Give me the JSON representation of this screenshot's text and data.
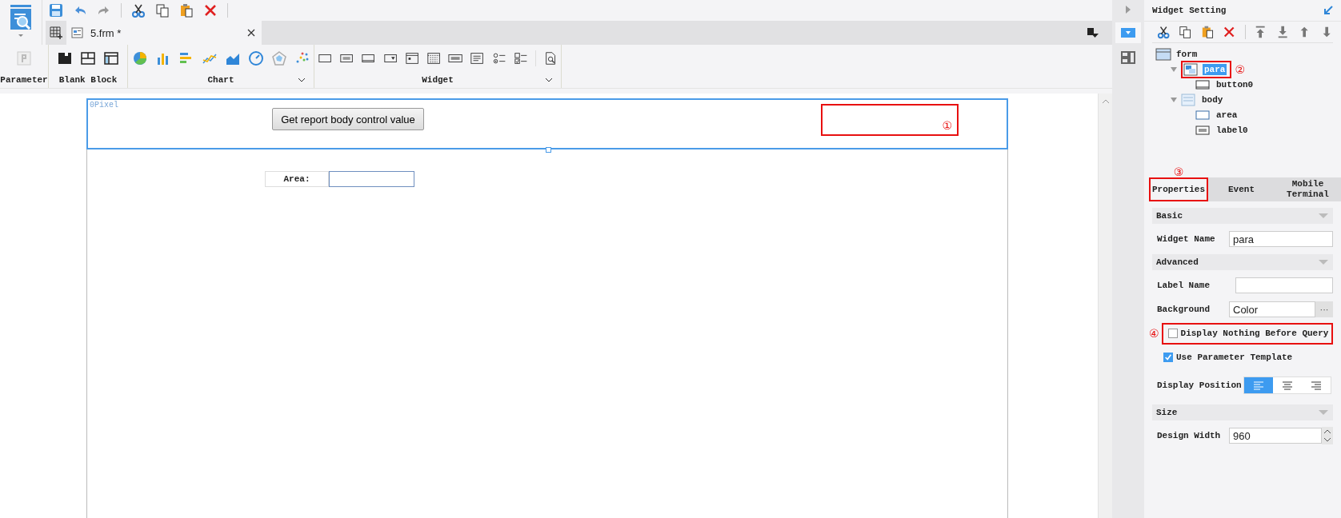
{
  "tabs": [
    {
      "label": "5.frm *",
      "selected": true
    }
  ],
  "ribbon_groups": [
    {
      "kind": "parameter",
      "label": "Parameter"
    },
    {
      "kind": "block",
      "label": "Blank Block"
    },
    {
      "kind": "chart",
      "label": "Chart"
    },
    {
      "kind": "widget",
      "label": "Widget"
    }
  ],
  "canvas": {
    "pane_label": "0Pixel",
    "button": "Get report body control value",
    "callout": "①",
    "fields": [
      {
        "label": "Area:"
      }
    ]
  },
  "side_panel": {
    "title": "Widget Setting",
    "tree": [
      {
        "label": "form",
        "kind": "form",
        "selected": false,
        "children": [
          {
            "label": "para",
            "kind": "para",
            "selected": true,
            "callout": "②",
            "expanded": true,
            "children": [
              {
                "label": "button0",
                "kind": "button",
                "selected": false
              }
            ]
          },
          {
            "label": "body",
            "kind": "body",
            "selected": false,
            "expanded": true,
            "children": [
              {
                "label": "area",
                "kind": "area",
                "selected": false
              },
              {
                "label": "label0",
                "kind": "label",
                "selected": false
              }
            ]
          }
        ]
      }
    ],
    "tabs": [
      {
        "label": "Properties",
        "selected": true,
        "callout": "③"
      },
      {
        "label": "Event",
        "selected": false
      },
      {
        "label": "Mobile Terminal",
        "selected": false
      }
    ],
    "rows": [
      {
        "kind": "section",
        "label": "Basic"
      },
      {
        "kind": "text",
        "label": "Widget Name",
        "value": "para"
      },
      {
        "kind": "section",
        "label": "Advanced"
      },
      {
        "kind": "text",
        "label": "Label Name"
      },
      {
        "kind": "color",
        "label": "Background",
        "value": "Color",
        "button": "···"
      },
      {
        "kind": "checkbox",
        "label": "Display Nothing Before Query",
        "checked": false,
        "callout": "④"
      },
      {
        "kind": "checkbox",
        "label": "Use Parameter Template",
        "checked": true
      },
      {
        "kind": "align",
        "label": "Display Position",
        "options": [
          {
            "selected": true
          },
          {
            "selected": false
          },
          {
            "selected": false
          }
        ]
      },
      {
        "kind": "section",
        "label": "Size"
      },
      {
        "kind": "number",
        "label": "Design Width",
        "value": "960"
      }
    ]
  }
}
